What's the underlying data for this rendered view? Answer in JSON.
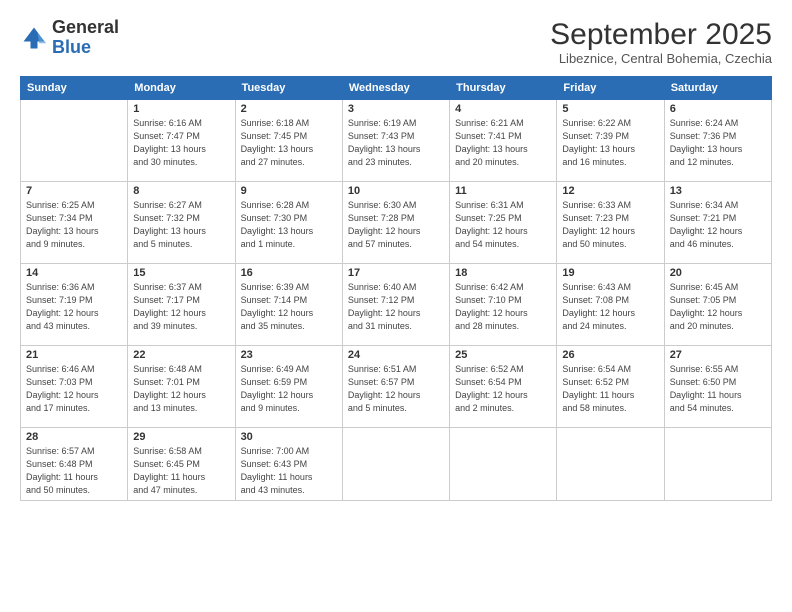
{
  "header": {
    "logo_general": "General",
    "logo_blue": "Blue",
    "month_title": "September 2025",
    "location": "Libeznice, Central Bohemia, Czechia"
  },
  "weekdays": [
    "Sunday",
    "Monday",
    "Tuesday",
    "Wednesday",
    "Thursday",
    "Friday",
    "Saturday"
  ],
  "weeks": [
    [
      {
        "day": "",
        "info": ""
      },
      {
        "day": "1",
        "info": "Sunrise: 6:16 AM\nSunset: 7:47 PM\nDaylight: 13 hours\nand 30 minutes."
      },
      {
        "day": "2",
        "info": "Sunrise: 6:18 AM\nSunset: 7:45 PM\nDaylight: 13 hours\nand 27 minutes."
      },
      {
        "day": "3",
        "info": "Sunrise: 6:19 AM\nSunset: 7:43 PM\nDaylight: 13 hours\nand 23 minutes."
      },
      {
        "day": "4",
        "info": "Sunrise: 6:21 AM\nSunset: 7:41 PM\nDaylight: 13 hours\nand 20 minutes."
      },
      {
        "day": "5",
        "info": "Sunrise: 6:22 AM\nSunset: 7:39 PM\nDaylight: 13 hours\nand 16 minutes."
      },
      {
        "day": "6",
        "info": "Sunrise: 6:24 AM\nSunset: 7:36 PM\nDaylight: 13 hours\nand 12 minutes."
      }
    ],
    [
      {
        "day": "7",
        "info": "Sunrise: 6:25 AM\nSunset: 7:34 PM\nDaylight: 13 hours\nand 9 minutes."
      },
      {
        "day": "8",
        "info": "Sunrise: 6:27 AM\nSunset: 7:32 PM\nDaylight: 13 hours\nand 5 minutes."
      },
      {
        "day": "9",
        "info": "Sunrise: 6:28 AM\nSunset: 7:30 PM\nDaylight: 13 hours\nand 1 minute."
      },
      {
        "day": "10",
        "info": "Sunrise: 6:30 AM\nSunset: 7:28 PM\nDaylight: 12 hours\nand 57 minutes."
      },
      {
        "day": "11",
        "info": "Sunrise: 6:31 AM\nSunset: 7:25 PM\nDaylight: 12 hours\nand 54 minutes."
      },
      {
        "day": "12",
        "info": "Sunrise: 6:33 AM\nSunset: 7:23 PM\nDaylight: 12 hours\nand 50 minutes."
      },
      {
        "day": "13",
        "info": "Sunrise: 6:34 AM\nSunset: 7:21 PM\nDaylight: 12 hours\nand 46 minutes."
      }
    ],
    [
      {
        "day": "14",
        "info": "Sunrise: 6:36 AM\nSunset: 7:19 PM\nDaylight: 12 hours\nand 43 minutes."
      },
      {
        "day": "15",
        "info": "Sunrise: 6:37 AM\nSunset: 7:17 PM\nDaylight: 12 hours\nand 39 minutes."
      },
      {
        "day": "16",
        "info": "Sunrise: 6:39 AM\nSunset: 7:14 PM\nDaylight: 12 hours\nand 35 minutes."
      },
      {
        "day": "17",
        "info": "Sunrise: 6:40 AM\nSunset: 7:12 PM\nDaylight: 12 hours\nand 31 minutes."
      },
      {
        "day": "18",
        "info": "Sunrise: 6:42 AM\nSunset: 7:10 PM\nDaylight: 12 hours\nand 28 minutes."
      },
      {
        "day": "19",
        "info": "Sunrise: 6:43 AM\nSunset: 7:08 PM\nDaylight: 12 hours\nand 24 minutes."
      },
      {
        "day": "20",
        "info": "Sunrise: 6:45 AM\nSunset: 7:05 PM\nDaylight: 12 hours\nand 20 minutes."
      }
    ],
    [
      {
        "day": "21",
        "info": "Sunrise: 6:46 AM\nSunset: 7:03 PM\nDaylight: 12 hours\nand 17 minutes."
      },
      {
        "day": "22",
        "info": "Sunrise: 6:48 AM\nSunset: 7:01 PM\nDaylight: 12 hours\nand 13 minutes."
      },
      {
        "day": "23",
        "info": "Sunrise: 6:49 AM\nSunset: 6:59 PM\nDaylight: 12 hours\nand 9 minutes."
      },
      {
        "day": "24",
        "info": "Sunrise: 6:51 AM\nSunset: 6:57 PM\nDaylight: 12 hours\nand 5 minutes."
      },
      {
        "day": "25",
        "info": "Sunrise: 6:52 AM\nSunset: 6:54 PM\nDaylight: 12 hours\nand 2 minutes."
      },
      {
        "day": "26",
        "info": "Sunrise: 6:54 AM\nSunset: 6:52 PM\nDaylight: 11 hours\nand 58 minutes."
      },
      {
        "day": "27",
        "info": "Sunrise: 6:55 AM\nSunset: 6:50 PM\nDaylight: 11 hours\nand 54 minutes."
      }
    ],
    [
      {
        "day": "28",
        "info": "Sunrise: 6:57 AM\nSunset: 6:48 PM\nDaylight: 11 hours\nand 50 minutes."
      },
      {
        "day": "29",
        "info": "Sunrise: 6:58 AM\nSunset: 6:45 PM\nDaylight: 11 hours\nand 47 minutes."
      },
      {
        "day": "30",
        "info": "Sunrise: 7:00 AM\nSunset: 6:43 PM\nDaylight: 11 hours\nand 43 minutes."
      },
      {
        "day": "",
        "info": ""
      },
      {
        "day": "",
        "info": ""
      },
      {
        "day": "",
        "info": ""
      },
      {
        "day": "",
        "info": ""
      }
    ]
  ]
}
